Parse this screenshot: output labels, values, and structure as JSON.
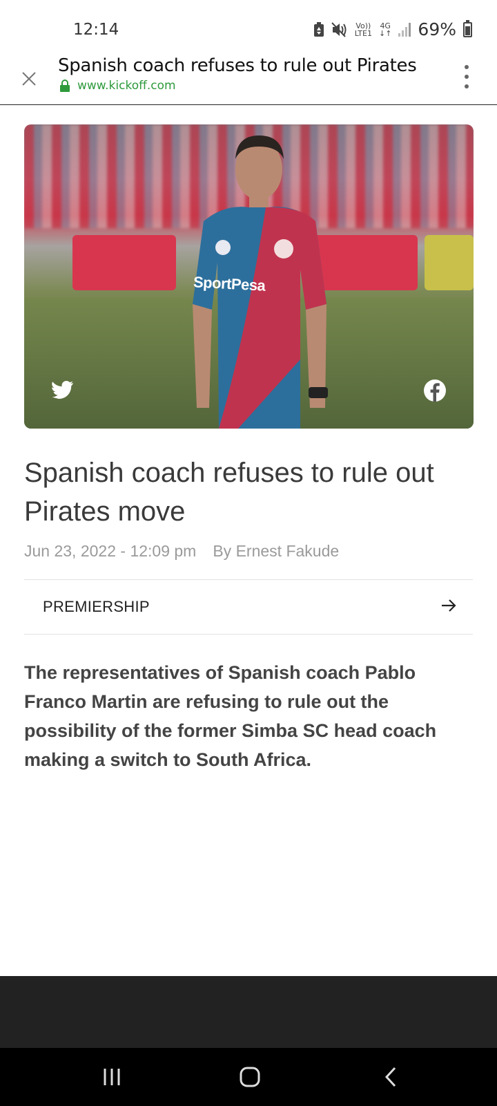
{
  "status_bar": {
    "time": "12:14",
    "volte_top": "Vo))",
    "volte_bottom": "LTE1",
    "network_top": "4G",
    "network_bottom": "↓↑",
    "battery_percent": "69%",
    "battery_level": 0.69
  },
  "tab": {
    "title": "Spanish coach refuses to rule out Pirates",
    "url": "www.kickoff.com"
  },
  "hero": {
    "shirt_text": "SportPesa"
  },
  "article": {
    "headline": "Spanish coach refuses to rule out Pirates move",
    "date": "Jun 23, 2022 - 12:09 pm",
    "author": "By Ernest Fakude",
    "category": "PREMIERSHIP",
    "lead": "The representatives of Spanish coach Pablo Franco Martin are refusing to rule out the possibility of the former Simba SC head coach making a switch to South Africa."
  },
  "colors": {
    "url_green": "#2e9a3c",
    "headline": "#3a3a3a",
    "meta_gray": "#9a9a9a",
    "bottom_band": "#222222",
    "nav_bar": "#000000"
  },
  "icons": {
    "close": "close-icon",
    "lock": "lock-icon",
    "menu": "more-vertical-icon",
    "twitter": "twitter-icon",
    "facebook": "facebook-icon",
    "arrow": "arrow-right-icon",
    "recent": "recent-apps-icon",
    "home": "home-icon",
    "back": "back-icon"
  }
}
